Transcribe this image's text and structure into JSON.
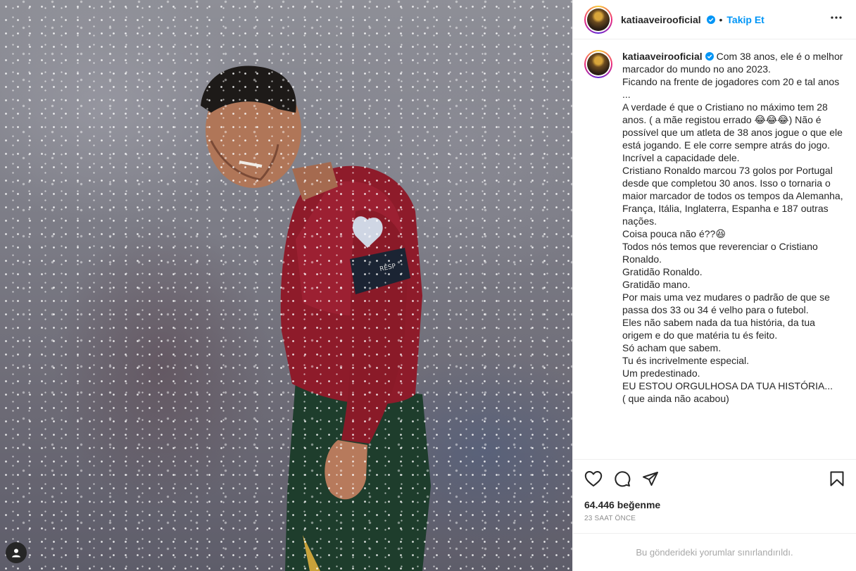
{
  "post": {
    "username": "katiaaveirooficial",
    "follow_label": "Takip Et",
    "separator": "•",
    "verified": true
  },
  "caption": {
    "username": "katiaaveirooficial",
    "paragraphs": [
      "Com 38 anos, ele é o melhor marcador do mundo no ano 2023.\nFicando na frente de jogadores com 20 e tal anos ...\nA verdade é que o Cristiano no máximo tem 28 anos. ( a mãe registou errado 😂😂😂) Não é possível que um atleta de 38 anos jogue o que ele está jogando. E ele corre sempre atrás do jogo. Incrível a capacidade dele.",
      "",
      "Cristiano Ronaldo marcou 73 golos por Portugal desde que completou 30 anos. Isso o tornaria o maior marcador de todos os tempos da Alemanha, França, Itália, Inglaterra, Espanha e 187 outras nações.\nCoisa pouca não é??😆\nTodos nós temos que reverenciar o Cristiano Ronaldo.\nGratidão Ronaldo.\nGratidão mano.",
      "",
      "Por mais uma vez mudares o padrão de que se passa dos 33 ou 34 é velho para o futebol.\nEles não sabem nada da tua história, da tua origem e do que matéria tu és feito.\nSó acham que sabem.",
      "",
      "Tu és incrivelmente especial.\nUm predestinado.",
      "",
      "EU ESTOU ORGULHOSA DA TUA HISTÓRIA...\n( que ainda não acabou)"
    ]
  },
  "stats": {
    "likes": "64.446 beğenme",
    "time_ago": "23 SAAT ÖNCE"
  },
  "comments": {
    "limited_notice": "Bu gönderideki yorumlar sınırlandırıldı."
  },
  "icons": {
    "like": "heart-icon",
    "comment": "comment-icon",
    "share": "paper-plane-icon",
    "save": "bookmark-icon",
    "more": "more-horizontal-icon",
    "verified": "verified-badge-icon",
    "tagged_user": "user-icon"
  },
  "colors": {
    "accent_blue": "#0095f6",
    "verified_blue": "#0095f6",
    "text": "#262626",
    "muted": "#8e8e8e",
    "border": "#efefef"
  }
}
